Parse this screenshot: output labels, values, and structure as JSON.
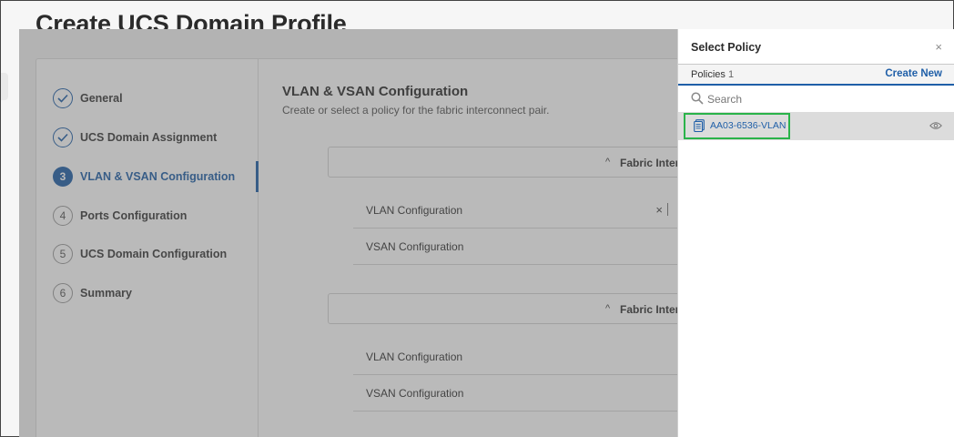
{
  "page": {
    "title": "Create UCS Domain Profile"
  },
  "steps": [
    {
      "marker": "",
      "label": "General",
      "state": "done"
    },
    {
      "marker": "",
      "label": "UCS Domain Assignment",
      "state": "done"
    },
    {
      "marker": "3",
      "label": "VLAN & VSAN Configuration",
      "state": "active"
    },
    {
      "marker": "4",
      "label": "Ports Configuration",
      "state": "pending"
    },
    {
      "marker": "5",
      "label": "UCS Domain Configuration",
      "state": "pending"
    },
    {
      "marker": "6",
      "label": "Summary",
      "state": "pending"
    }
  ],
  "content": {
    "title": "VLAN & VSAN Configuration",
    "subtitle": "Create or select a policy for the fabric interconnect pair.",
    "fabric_a": {
      "title": "Fabric Interc",
      "vlan_label": "VLAN Configuration",
      "vsan_label": "VSAN Configuration",
      "clear_glyph": "×"
    },
    "fabric_b": {
      "title": "Fabric Interc",
      "vlan_label": "VLAN Configuration",
      "vsan_label": "VSAN Configuration"
    },
    "caret_glyph": "^"
  },
  "drawer": {
    "title": "Select Policy",
    "close_glyph": "×",
    "policies_label": "Policies",
    "policies_count": "1",
    "create_new_label": "Create New",
    "search": {
      "placeholder": "Search",
      "value": ""
    },
    "items": [
      {
        "name": "AA03-6536-VLAN"
      }
    ]
  },
  "colors": {
    "accent": "#1f5fa8",
    "highlight": "#2ab34a",
    "overlay": "#5a5a5a"
  }
}
